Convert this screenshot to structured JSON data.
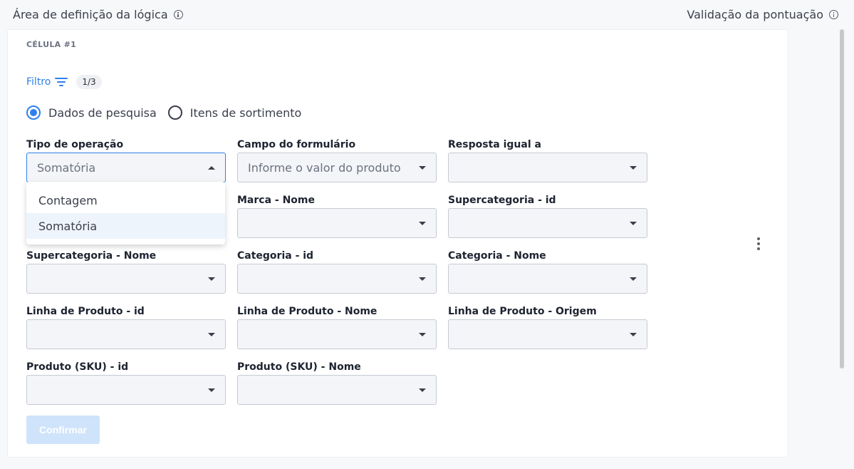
{
  "header": {
    "left_title": "Área de definição da lógica",
    "right_title": "Validação da pontuação"
  },
  "cell": {
    "label": "CÉLULA #1"
  },
  "filter": {
    "label": "Filtro",
    "badge": "1/3"
  },
  "radios": [
    {
      "label": "Dados de pesquisa",
      "checked": true
    },
    {
      "label": "Itens de sortimento",
      "checked": false
    }
  ],
  "fields": {
    "tipo_operacao": {
      "label": "Tipo de operação",
      "value": "Somatória"
    },
    "campo_formulario": {
      "label": "Campo do formulário",
      "placeholder": "Informe o valor do produto"
    },
    "resposta_igual": {
      "label": "Resposta igual a",
      "value": ""
    },
    "marca_nome": {
      "label": "Marca - Nome",
      "value": ""
    },
    "supercategoria_id": {
      "label": "Supercategoria - id",
      "value": ""
    },
    "supercategoria_nome": {
      "label": "Supercategoria - Nome",
      "value": ""
    },
    "categoria_id": {
      "label": "Categoria - id",
      "value": ""
    },
    "categoria_nome": {
      "label": "Categoria - Nome",
      "value": ""
    },
    "linha_produto_id": {
      "label": "Linha de Produto - id",
      "value": ""
    },
    "linha_produto_nome": {
      "label": "Linha de Produto - Nome",
      "value": ""
    },
    "linha_produto_origem": {
      "label": "Linha de Produto - Origem",
      "value": ""
    },
    "produto_sku_id": {
      "label": "Produto (SKU) - id",
      "value": ""
    },
    "produto_sku_nome": {
      "label": "Produto (SKU) - Nome",
      "value": ""
    }
  },
  "dropdown": {
    "options": [
      {
        "label": "Contagem",
        "selected": false
      },
      {
        "label": "Somatória",
        "selected": true
      }
    ]
  },
  "actions": {
    "confirm_label": "Confirmar"
  },
  "colors": {
    "accent": "#2f80ed",
    "confirm_disabled": "#cfe3fb"
  }
}
